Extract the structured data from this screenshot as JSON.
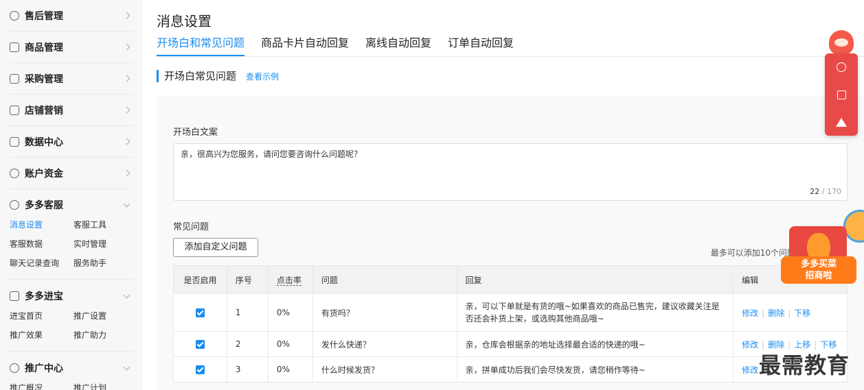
{
  "sidebar": {
    "items": [
      {
        "label": "售后管理",
        "icon": "shield-icon"
      },
      {
        "label": "商品管理",
        "icon": "bag-icon"
      },
      {
        "label": "采购管理",
        "icon": "list-icon"
      },
      {
        "label": "店铺营销",
        "icon": "store-icon"
      },
      {
        "label": "数据中心",
        "icon": "bar-chart-icon"
      },
      {
        "label": "账户资金",
        "icon": "yen-icon"
      },
      {
        "label": "多多客服",
        "icon": "headset-icon"
      },
      {
        "label": "多多进宝",
        "icon": "treasure-icon"
      },
      {
        "label": "推广中心",
        "icon": "share-icon"
      }
    ],
    "kefu_sub": [
      "消息设置",
      "客服工具",
      "客服数据",
      "实时管理",
      "聊天记录查询",
      "服务助手"
    ],
    "jinbao_sub": [
      "进宝首页",
      "推广设置",
      "推广效果",
      "推广助力"
    ],
    "tuiguang_sub": [
      "推广概况",
      "推广计划"
    ]
  },
  "page": {
    "title": "消息设置",
    "tabs": [
      "开场白和常见问题",
      "商品卡片自动回复",
      "离线自动回复",
      "订单自动回复"
    ],
    "section_title": "开场白常见问题",
    "example_link": "查看示例"
  },
  "opening": {
    "label": "开场白文案",
    "text": "亲，很高兴为您服务，请问您要咨询什么问题呢？",
    "count": "22",
    "max": " / 170"
  },
  "faq": {
    "label": "常见问题",
    "add_button": "添加自定义问题",
    "limit_text": "最多可以添加10个问题，最多可以",
    "headers": [
      "是否启用",
      "序号",
      "点击率",
      "问题",
      "回复",
      "编辑"
    ],
    "rows": [
      {
        "enabled": true,
        "index": "1",
        "rate": "0%",
        "question": "有货吗？",
        "reply": "亲，可以下单就是有货的哦~如果喜欢的商品已售完，建议收藏关注是否还会补货上架，或选购其他商品哦~",
        "actions": [
          "修改",
          "删除",
          "下移"
        ]
      },
      {
        "enabled": true,
        "index": "2",
        "rate": "0%",
        "question": "发什么快递？",
        "reply": "亲，仓库会根据亲的地址选择最合适的快递的哦~",
        "actions": [
          "修改",
          "删除",
          "上移",
          "下移"
        ]
      },
      {
        "enabled": true,
        "index": "3",
        "rate": "0%",
        "question": "什么时候发货？",
        "reply": "亲，拼单成功后我们会尽快发货，请您稍作等待~",
        "actions": [
          "修改"
        ]
      }
    ]
  },
  "float": {
    "promo_text_1": "多多买菜",
    "promo_text_2": "招商啦"
  },
  "watermark": "最需教育",
  "colors": {
    "accent": "#1a8cf0",
    "float_red": "#e84a4a"
  }
}
